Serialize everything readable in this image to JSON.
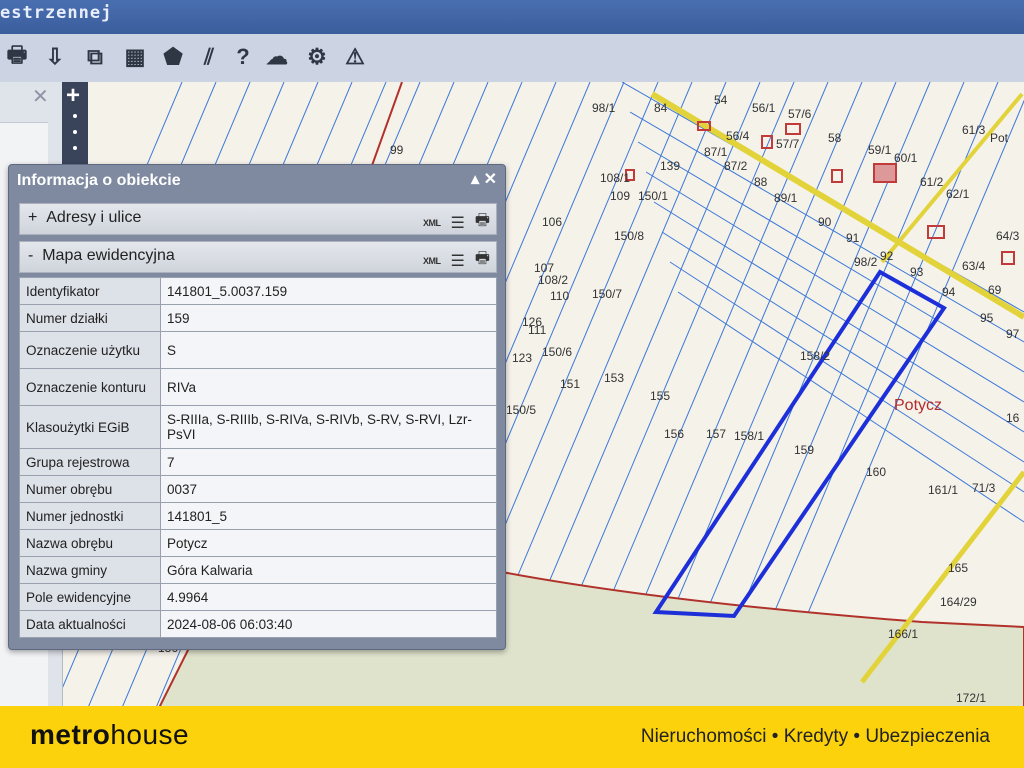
{
  "window": {
    "title": "estrzennej"
  },
  "toolbar": {
    "icons": [
      "print-icon",
      "pointer-icon",
      "layers-icon",
      "layout-icon",
      "shape-icon",
      "hatch-icon",
      "help-icon",
      "cloud-upload-icon",
      "settings-icon",
      "warning-icon"
    ]
  },
  "map": {
    "parcels": [
      "99",
      "98/1",
      "84",
      "54",
      "56/1",
      "57/6",
      "58",
      "59/1",
      "60/1",
      "61/3",
      "Pot",
      "87/1",
      "56/4",
      "57/7",
      "61/2",
      "62/1",
      "139",
      "87/2",
      "88",
      "108/1",
      "109",
      "150/1",
      "89/1",
      "90",
      "91",
      "64/3",
      "106",
      "150/8",
      "92",
      "98/2",
      "93",
      "63/4",
      "107",
      "108/2",
      "110",
      "150/7",
      "94",
      "69",
      "95",
      "97",
      "126",
      "111",
      "123",
      "150/6",
      "151",
      "153",
      "155",
      "158/2",
      "150/5",
      "156",
      "157",
      "158/1",
      "159",
      "160",
      "161/1",
      "71/3",
      "165",
      "164/29",
      "166/1",
      "136",
      "172/1",
      "16"
    ],
    "place_label": "Potycz"
  },
  "panel": {
    "title": "Informacja o obiekcie",
    "sections": [
      {
        "prefix": "+",
        "label": "Adresy i ulice",
        "xml": "XML"
      },
      {
        "prefix": "-",
        "label": "Mapa ewidencyjna",
        "xml": "XML"
      }
    ],
    "rows": [
      {
        "k": "Identyfikator",
        "v": "141801_5.0037.159"
      },
      {
        "k": "Numer działki",
        "v": "159"
      },
      {
        "k": "Oznaczenie użytku",
        "v": "S"
      },
      {
        "k": "Oznaczenie konturu",
        "v": "RIVa"
      },
      {
        "k": "Klasoużytki EGiB",
        "v": "S-RIIIa, S-RIIIb, S-RIVa, S-RIVb, S-RV, S-RVI, Lzr-PsVI"
      },
      {
        "k": "Grupa rejestrowa",
        "v": "7"
      },
      {
        "k": "Numer obrębu",
        "v": "0037"
      },
      {
        "k": "Numer jednostki",
        "v": "141801_5"
      },
      {
        "k": "Nazwa obrębu",
        "v": "Potycz"
      },
      {
        "k": "Nazwa gminy",
        "v": "Góra Kalwaria"
      },
      {
        "k": "Pole ewidencyjne",
        "v": "4.9964"
      },
      {
        "k": "Data aktualności",
        "v": "2024-08-06 06:03:40"
      }
    ]
  },
  "watermark": "metro",
  "footer": {
    "logo_a": "metr",
    "logo_b": "o",
    "logo_c": "house",
    "tagline": "Nieruchomości • Kredyty • Ubezpieczenia"
  }
}
